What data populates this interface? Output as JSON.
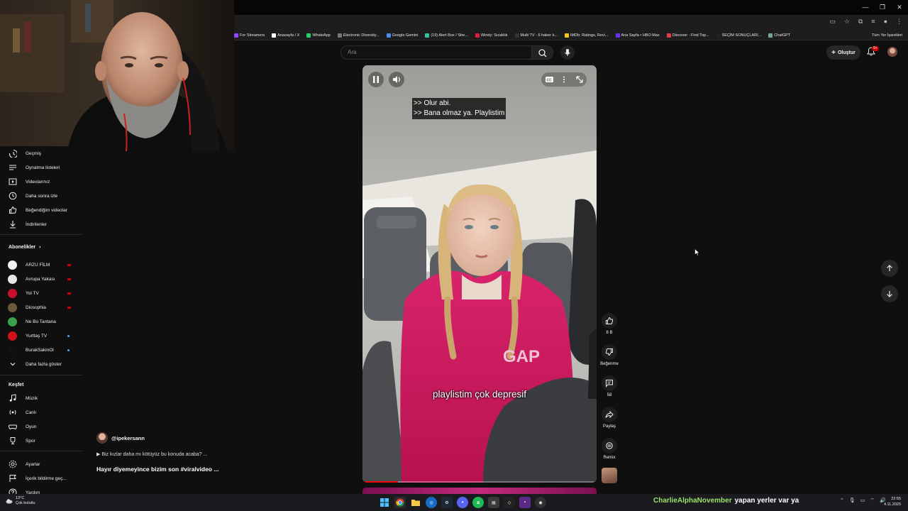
{
  "browser": {
    "bookmarks": [
      {
        "label": "For Streamers",
        "color": "#9146ff"
      },
      {
        "label": "Anasayfa / X",
        "color": "#ffffff"
      },
      {
        "label": "WhatsApp",
        "color": "#25d366"
      },
      {
        "label": "Electronic Diversity...",
        "color": "#777777"
      },
      {
        "label": "Google Gemini",
        "color": "#4c8bf5"
      },
      {
        "label": "(19) Alert Box / Stre...",
        "color": "#31c3a2"
      },
      {
        "label": "Windy: Sıcaklık",
        "color": "#d81f3b"
      },
      {
        "label": "Multi TV - 6 haber k...",
        "color": "#333333"
      },
      {
        "label": "IMDb: Ratings, Revi...",
        "color": "#f5c518"
      },
      {
        "label": "Ana Sayfa • HBO Max",
        "color": "#6b2cf5"
      },
      {
        "label": "Discover - Find Top...",
        "color": "#e63946"
      },
      {
        "label": "SEÇİM SONUÇLARI...",
        "color": "#222222"
      },
      {
        "label": "ChatGPT",
        "color": "#74aa9c"
      }
    ],
    "all_bookmarks_label": "Tüm Yer İşaretleri"
  },
  "youtube": {
    "search": {
      "placeholder": "Ara"
    },
    "create_label": "Oluştur",
    "notification_count": "9+"
  },
  "sidebar": {
    "you_items": [
      {
        "label": "Geçmiş",
        "icon": "history-icon"
      },
      {
        "label": "Oynatma listeleri",
        "icon": "playlist-icon"
      },
      {
        "label": "Videolarınız",
        "icon": "your-videos-icon"
      },
      {
        "label": "Daha sonra izle",
        "icon": "watch-later-icon"
      },
      {
        "label": "Beğendiğim videolar",
        "icon": "liked-videos-icon"
      },
      {
        "label": "İndirilenler",
        "icon": "download-icon"
      }
    ],
    "subscriptions_heading": "Abonelikler",
    "subscriptions": [
      {
        "label": "ARZU FİLM",
        "avatar_color": "#f3f3f3",
        "indicator": "live",
        "indicator_color": "#cc0000"
      },
      {
        "label": "Avrupa Yakası",
        "avatar_color": "#e8e8e8",
        "indicator": "live",
        "indicator_color": "#cc0000"
      },
      {
        "label": "Yol TV",
        "avatar_color": "#c8102e",
        "indicator": "live",
        "indicator_color": "#cc0000"
      },
      {
        "label": "Diosophia",
        "avatar_color": "#6b5a3a",
        "indicator": "live",
        "indicator_color": "#cc0000"
      },
      {
        "label": "Ne Bu Tantana",
        "avatar_color": "#3aa04a",
        "indicator": "",
        "indicator_color": ""
      },
      {
        "label": "Yurttaş TV",
        "avatar_color": "#d0101a",
        "indicator": "new",
        "indicator_color": "#3ea6ff"
      },
      {
        "label": "BurakSakinOl",
        "avatar_color": "#111111",
        "indicator": "new",
        "indicator_color": "#3ea6ff"
      }
    ],
    "show_more": "Daha fazla göster",
    "explore_heading": "Keşfet",
    "explore": [
      {
        "label": "Müzik",
        "icon": "music-icon"
      },
      {
        "label": "Canlı",
        "icon": "live-icon"
      },
      {
        "label": "Oyun",
        "icon": "gaming-icon"
      },
      {
        "label": "Spor",
        "icon": "sports-icon"
      }
    ],
    "settings": [
      {
        "label": "Ayarlar",
        "icon": "settings-icon"
      },
      {
        "label": "İçerik bildirme geç...",
        "icon": "report-history-icon"
      },
      {
        "label": "Yardım",
        "icon": "help-icon"
      }
    ]
  },
  "short": {
    "caption_lines": [
      ">> Olur abi.",
      ">> Bana olmaz ya. Playlistim"
    ],
    "subtitle": "playlistim çok depresif",
    "progress": 0.15,
    "channel": "@ipekersann",
    "description": "▶ Biz kızlar daha mı kötüyüz bu konuda acaba? ...",
    "title": "Hayır diyemeyince bizim son #viralvideo ..."
  },
  "actions": {
    "like_count": "8 B",
    "dislike_label": "Beğenme",
    "comment_count": "58",
    "share_label": "Paylaş",
    "remix_label": "Remix"
  },
  "taskbar": {
    "weather_temp": "13°C",
    "weather_desc": "Çok bulutlu",
    "chat_user": "CharlieAlphaNovember",
    "chat_message": "yapan yerler var ya",
    "time": "22:55",
    "date": "4.11.2025"
  }
}
